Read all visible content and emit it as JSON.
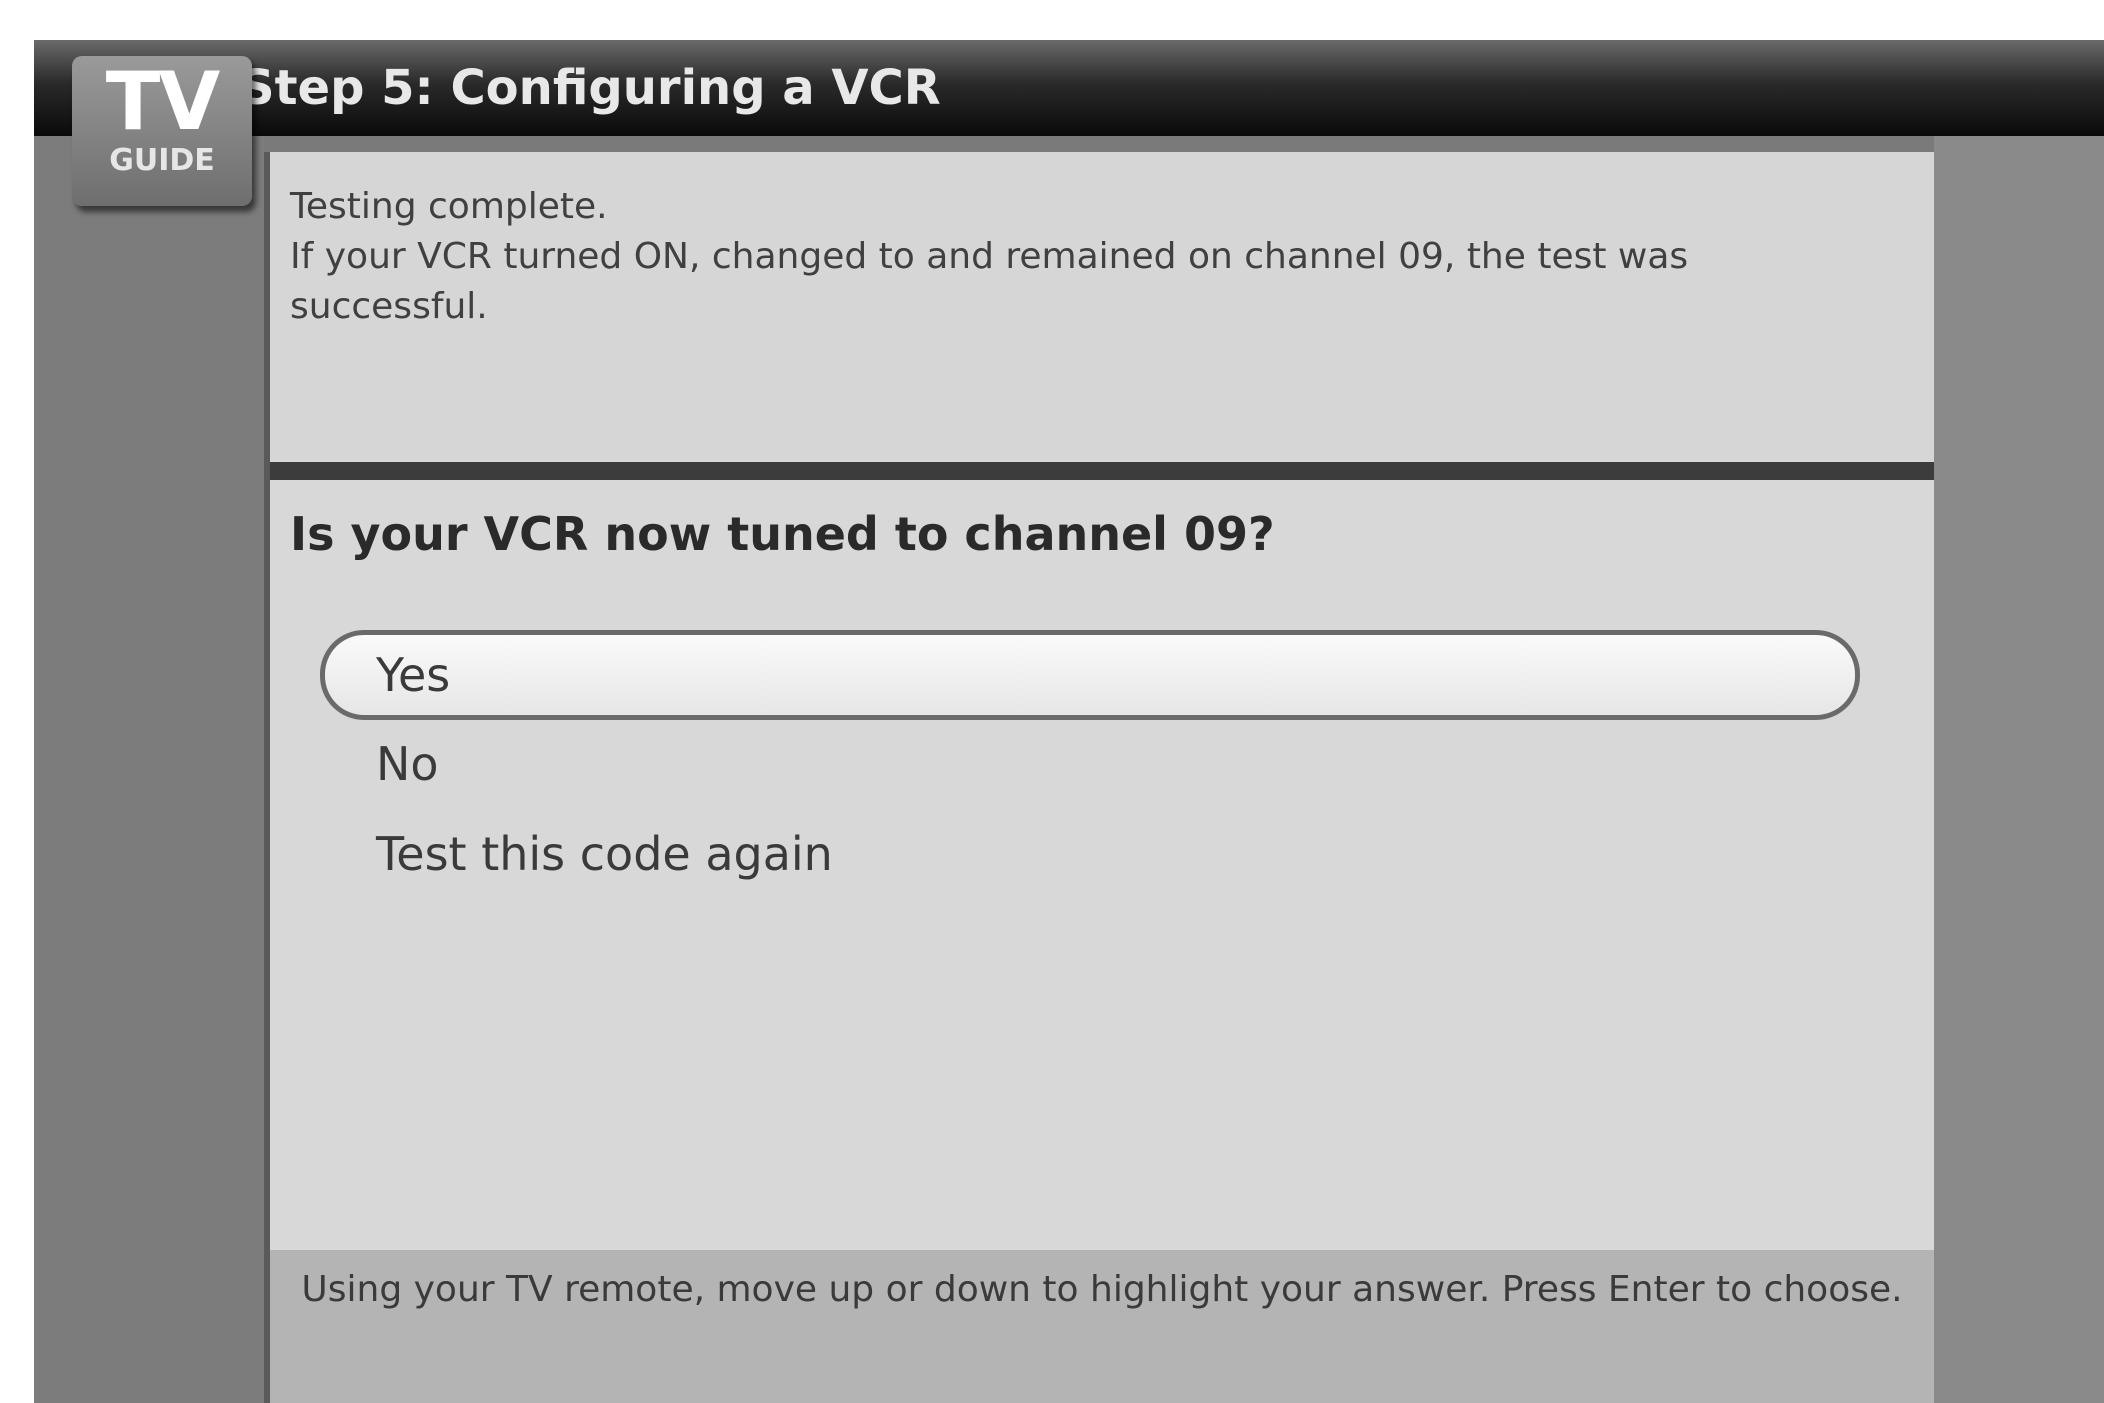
{
  "header": {
    "logo": {
      "primary": "TV",
      "secondary": "GUIDE"
    },
    "title": "Step 5: Configuring a VCR"
  },
  "info": {
    "lines": [
      "Testing complete.",
      "If your VCR turned ON, changed to and remained on channel 09, the test was successful."
    ]
  },
  "question": "Is your VCR now tuned to channel 09?",
  "options": [
    {
      "label": "Yes",
      "selected": true
    },
    {
      "label": "No",
      "selected": false
    },
    {
      "label": "Test this code again",
      "selected": false
    }
  ],
  "footer": {
    "instructions": "Using your TV remote, move up or down to highlight your answer. Press Enter to choose."
  },
  "colors": {
    "title_bar": "#0a0a0a",
    "panel": "#d8d8d8",
    "divider": "#3c3c3c",
    "background": "#7a7a7a",
    "highlight": "#f0f0f0"
  }
}
